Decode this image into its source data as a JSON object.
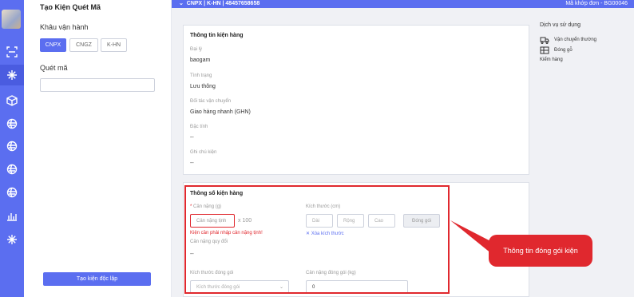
{
  "sidebar": {
    "title": "Tạo Kiện Quét Mã",
    "khau_label": "Khâu vận hành",
    "segments": [
      "CNPX",
      "CNGZ",
      "K-HN"
    ],
    "scan_label": "Quét mã",
    "create_button": "Tạo kiện độc lập"
  },
  "topbar": {
    "title": "CNPX | K-HN | 48457658658",
    "right": "Mã khớp đơn - BG00046"
  },
  "info": {
    "heading": "Thông tin kiện hàng",
    "fields": [
      {
        "label": "Đại lý",
        "value": "baogam"
      },
      {
        "label": "Tình trạng",
        "value": "Lưu thông"
      },
      {
        "label": "Đối tác vận chuyển",
        "value": "Giao hàng nhanh (GHN)"
      },
      {
        "label": "Đặc tính",
        "value": "--"
      },
      {
        "label": "Ghi chú kiện",
        "value": "--"
      }
    ]
  },
  "services": {
    "title": "Dịch vụ sử dụng",
    "items": [
      "Vận chuyển thường",
      "Đóng gỗ"
    ],
    "kiem_hang": "Kiểm hàng"
  },
  "params": {
    "heading": "Thông số kiện hàng",
    "required_mark": "*",
    "weight_label": "Cân nặng (g)",
    "weight_placeholder": "Cân nặng tịnh",
    "multiplier": "x 100",
    "error": "Kiện cần phải nhập cân nặng tịnh!",
    "dim_label": "Kích thước (cm)",
    "dim_placeholders": [
      "Dài",
      "Rộng",
      "Cao"
    ],
    "pack_button": "Đóng gói",
    "clear_dims": "Xóa kích thước",
    "converted_label": "Cân nặng quy đổi",
    "converted_value": "--",
    "pack_size_label": "Kích thước đóng gói",
    "pack_size_placeholder": "Kích thước đóng gói",
    "pack_weight_label": "Cân nặng đóng gói (kg)",
    "pack_weight_value": "0"
  },
  "callout": {
    "text": "Thông tin đóng gói kiện"
  },
  "colors": {
    "accent": "#5b6ef0",
    "callout": "#e0282e"
  }
}
